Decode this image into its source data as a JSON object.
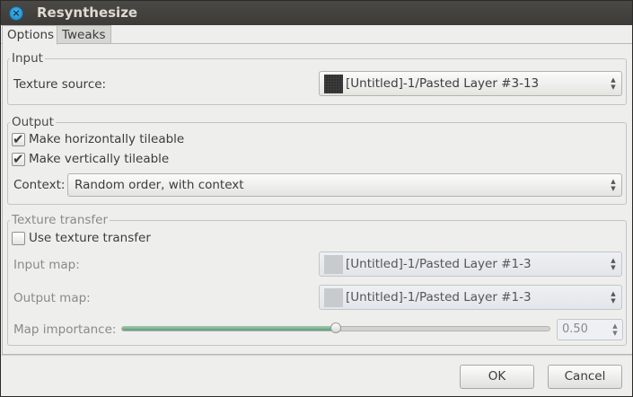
{
  "window": {
    "title": "Resynthesize"
  },
  "tabs": [
    {
      "label": "Options",
      "active": true
    },
    {
      "label": "Tweaks",
      "active": false
    }
  ],
  "input_group": {
    "title": "Input",
    "texture_source_label": "Texture source:",
    "texture_source_value": "[Untitled]-1/Pasted Layer #3-13"
  },
  "output_group": {
    "title": "Output",
    "make_h_tileable_label": "Make horizontally tileable",
    "make_h_tileable_checked": true,
    "make_v_tileable_label": "Make vertically tileable",
    "make_v_tileable_checked": true,
    "context_label": "Context:",
    "context_value": "Random order, with context"
  },
  "transfer_group": {
    "title": "Texture transfer",
    "use_transfer_label": "Use texture transfer",
    "use_transfer_checked": false,
    "input_map_label": "Input map:",
    "input_map_value": "[Untitled]-1/Pasted Layer #1-3",
    "output_map_label": "Output map:",
    "output_map_value": "[Untitled]-1/Pasted Layer #1-3",
    "map_importance_label": "Map importance:",
    "map_importance_value": "0.50",
    "map_importance_fraction": 0.5
  },
  "buttons": {
    "ok": "OK",
    "cancel": "Cancel"
  },
  "icons": {
    "close": "close-icon",
    "check": "checkmark-icon",
    "spin": "spin-arrows-icon"
  },
  "colors": {
    "titlebar": "#3c3b37",
    "accent": "#1a87c5",
    "slider_fill": "#5a9e79",
    "background": "#eeeeec"
  }
}
